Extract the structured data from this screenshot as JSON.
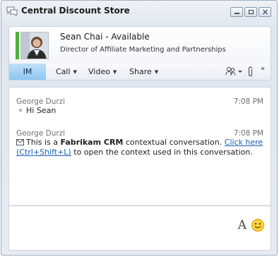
{
  "window": {
    "title": "Central Discount Store"
  },
  "contact": {
    "name_status": "Sean Chai - Available",
    "title": "Director of Affiliate Marketing and Partnerships",
    "presence_color": "#4fb13d"
  },
  "toolbar": {
    "im_label": "IM",
    "call_label": "Call",
    "video_label": "Video",
    "share_label": "Share",
    "more_glyph": "»",
    "icons": [
      "people-icon",
      "paperclip-icon",
      "chevron-double-right-icon"
    ]
  },
  "messages": [
    {
      "sender": "George Durzi",
      "time": "7:08 PM",
      "text": "Hi Sean"
    },
    {
      "sender": "George Durzi",
      "time": "7:08 PM",
      "text_before": "This is a ",
      "text_bold": "Fabrikam CRM",
      "text_middle": " contextual conversation. ",
      "link_text": "Click here (Ctrl+Shift+L)",
      "text_after": " to open the context used in this conversation."
    }
  ],
  "compose": {
    "font_label": "A",
    "icons": [
      "font-icon",
      "emoticon-icon"
    ]
  },
  "colors": {
    "accent": "#8ec6f1",
    "link": "#1a5fb4"
  }
}
